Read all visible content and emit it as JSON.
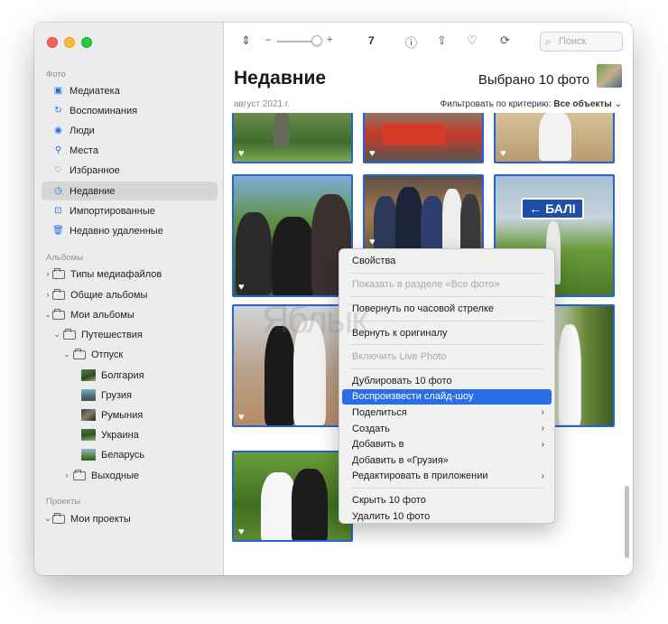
{
  "sidebar": {
    "section_photos": "Фото",
    "photos_items": [
      {
        "label": "Медиатека",
        "icon": "photo-library-icon"
      },
      {
        "label": "Воспоминания",
        "icon": "memories-icon"
      },
      {
        "label": "Люди",
        "icon": "people-icon"
      },
      {
        "label": "Места",
        "icon": "places-icon"
      },
      {
        "label": "Избранное",
        "icon": "heart-icon"
      },
      {
        "label": "Недавние",
        "icon": "clock-icon"
      },
      {
        "label": "Импортированные",
        "icon": "import-icon"
      },
      {
        "label": "Недавно удаленные",
        "icon": "trash-icon"
      }
    ],
    "section_albums": "Альбомы",
    "albums_items": [
      {
        "label": "Типы медиафайлов"
      },
      {
        "label": "Общие альбомы"
      },
      {
        "label": "Мои альбомы"
      },
      {
        "label": "Путешествия"
      },
      {
        "label": "Отпуск"
      },
      {
        "label": "Болгария"
      },
      {
        "label": "Грузия"
      },
      {
        "label": "Румыния"
      },
      {
        "label": "Украина"
      },
      {
        "label": "Беларусь"
      },
      {
        "label": "Выходные"
      }
    ],
    "section_projects": "Проекты",
    "projects_items": [
      {
        "label": "Мои проекты"
      }
    ],
    "selected": "Недавние"
  },
  "toolbar": {
    "count": "7",
    "search_placeholder": "Поиск"
  },
  "header": {
    "title": "Недавние",
    "selection": "Выбрано 10 фото",
    "date": "август 2021 г.",
    "filter_label": "Фильтровать по критерию:",
    "filter_value": "Все объекты"
  },
  "context_menu": {
    "items": [
      {
        "label": "Свойства",
        "state": "enabled"
      },
      {
        "label": "Показать в разделе «Все фото»",
        "state": "disabled"
      },
      {
        "label": "Повернуть по часовой стрелке",
        "state": "enabled"
      },
      {
        "label": "Вернуть к оригиналу",
        "state": "enabled"
      },
      {
        "label": "Включить Live Photo",
        "state": "disabled"
      },
      {
        "label": "Дублировать 10 фото",
        "state": "enabled"
      },
      {
        "label": "Воспроизвести слайд-шоу",
        "state": "highlighted"
      },
      {
        "label": "Поделиться",
        "state": "submenu"
      },
      {
        "label": "Создать",
        "state": "submenu"
      },
      {
        "label": "Добавить в",
        "state": "submenu"
      },
      {
        "label": "Добавить в «Грузия»",
        "state": "enabled"
      },
      {
        "label": "Редактировать в приложении",
        "state": "submenu"
      },
      {
        "label": "Скрыть 10 фото",
        "state": "enabled"
      },
      {
        "label": "Удалить 10 фото",
        "state": "enabled"
      }
    ]
  },
  "watermark": "Яблык",
  "colors": {
    "selection_border": "#2563d8",
    "menu_highlight": "#2a6ee4",
    "sidebar_bg": "#ececec"
  }
}
